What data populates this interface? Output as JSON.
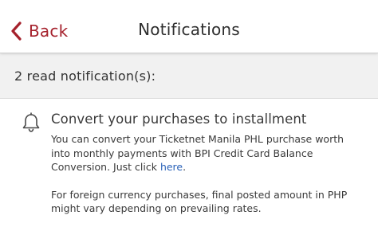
{
  "header": {
    "back_label": "Back",
    "title": "Notifications"
  },
  "section": {
    "label": "2 read notification(s):"
  },
  "notification": {
    "icon": "bell-icon",
    "title": "Convert your purchases to installment",
    "body_line1": "You can convert your Ticketnet Manila PHL purchase worth",
    "body_line2": "into monthly payments with BPI Credit Card Balance",
    "body_line3_prefix": "Conversion. Just click ",
    "link_text": "here",
    "body_line3_suffix": ".",
    "para2_line1": "For foreign currency purchases, final posted amount in PHP",
    "para2_line2": "might vary depending on prevailing rates."
  },
  "colors": {
    "accent": "#a5212c",
    "link": "#2a62b8",
    "section_bg": "#f1f1f1"
  }
}
